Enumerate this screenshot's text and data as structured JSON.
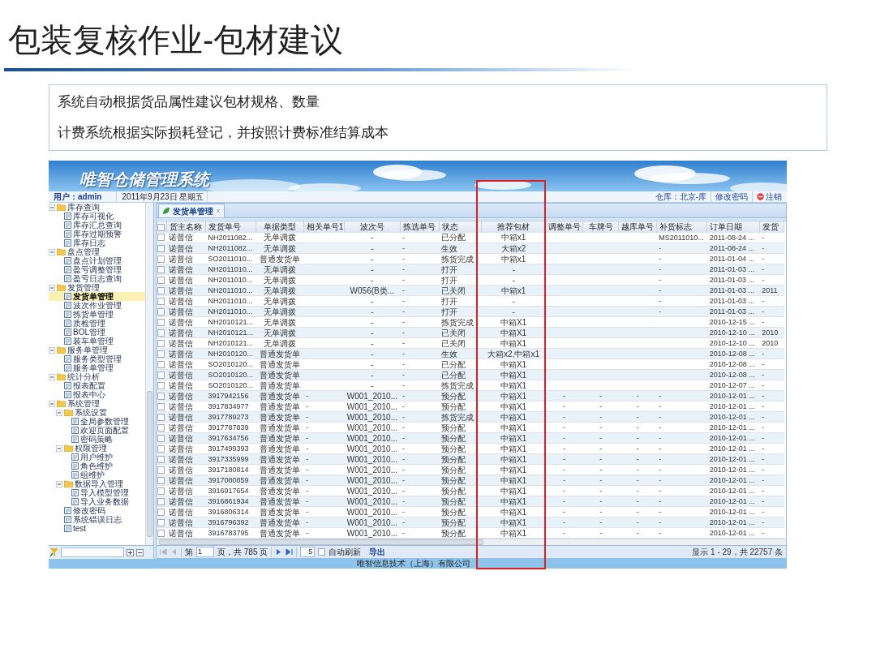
{
  "slide": {
    "title": "包装复核作业-包材建议",
    "points": [
      "系统自动根据货品属性建议包材规格、数量",
      "计费系统根据实际损耗登记，并按照计费标准结算成本"
    ]
  },
  "app": {
    "title": "唯智仓储管理系统",
    "user": "用户：admin",
    "date": "2011年9月23日 星期五",
    "warehouse": "仓库：北京-库",
    "change_password": "修改密码",
    "logout": "注销",
    "tree": [
      {
        "label": "库存查询",
        "expanded": true,
        "selected": false,
        "children": [
          {
            "label": "库存可视化",
            "selected": false
          },
          {
            "label": "库存汇总查询",
            "selected": false
          },
          {
            "label": "库存过期预警",
            "selected": false
          },
          {
            "label": "库存日志",
            "selected": false
          }
        ]
      },
      {
        "label": "盘点管理",
        "expanded": true,
        "selected": false,
        "children": [
          {
            "label": "盘点计划管理",
            "selected": false
          },
          {
            "label": "盈亏调整管理",
            "selected": false
          },
          {
            "label": "盈亏日志查询",
            "selected": false
          }
        ]
      },
      {
        "label": "发货管理",
        "expanded": true,
        "selected": false,
        "children": [
          {
            "label": "发货单管理",
            "selected": true
          },
          {
            "label": "波次作业管理",
            "selected": false
          },
          {
            "label": "拣货单管理",
            "selected": false
          },
          {
            "label": "质检管理",
            "selected": false
          },
          {
            "label": "BOL管理",
            "selected": false
          },
          {
            "label": "装车单管理",
            "selected": false
          }
        ]
      },
      {
        "label": "服务单管理",
        "expanded": true,
        "selected": false,
        "children": [
          {
            "label": "服务类型管理",
            "selected": false
          },
          {
            "label": "服务单管理",
            "selected": false
          }
        ]
      },
      {
        "label": "统计分析",
        "expanded": true,
        "selected": false,
        "children": [
          {
            "label": "报表配置",
            "selected": false
          },
          {
            "label": "报表中心",
            "selected": false
          }
        ]
      },
      {
        "label": "系统管理",
        "expanded": true,
        "selected": false,
        "children": [
          {
            "label": "系统设置",
            "expanded": true,
            "selected": false,
            "children": [
              {
                "label": "全局参数管理",
                "selected": false
              },
              {
                "label": "欢迎页面配置",
                "selected": false
              },
              {
                "label": "密码策略",
                "selected": false
              }
            ]
          },
          {
            "label": "权限管理",
            "expanded": true,
            "selected": false,
            "children": [
              {
                "label": "用户维护",
                "selected": false
              },
              {
                "label": "角色维护",
                "selected": false
              },
              {
                "label": "组维护",
                "selected": false
              }
            ]
          },
          {
            "label": "数据导入管理",
            "expanded": true,
            "selected": false,
            "children": [
              {
                "label": "导入模型管理",
                "selected": false
              },
              {
                "label": "导入业务数据",
                "selected": false
              }
            ]
          },
          {
            "label": "修改密码",
            "selected": false
          },
          {
            "label": "系统错误日志",
            "selected": false
          },
          {
            "label": "test",
            "selected": false
          }
        ]
      }
    ],
    "tab": {
      "label": "发货单管理",
      "selected": true
    },
    "select_all": {
      "checked": false
    },
    "columns": [
      "货主名称",
      "发货单号",
      "单据类型",
      "相关单号1",
      "波次号",
      "拣选单号",
      "状态",
      "推荐包材",
      "调整单号",
      "车牌号",
      "越库单号",
      "补货标志",
      "订单日期",
      "发货"
    ],
    "rows": [
      {
        "checked": false,
        "cells": [
          "诺普信",
          "NH2011082...",
          "无单调拨",
          null,
          "-",
          "-",
          "已分配",
          "中箱x1",
          null,
          null,
          null,
          "MS2011010...",
          "2011-08-24 ...",
          "-"
        ]
      },
      {
        "checked": false,
        "cells": [
          "诺普信",
          "NH2011082...",
          "无单调拨",
          null,
          "-",
          "-",
          "生效",
          "大箱x2",
          null,
          null,
          null,
          "-",
          "2011-08-24 ...",
          "-"
        ]
      },
      {
        "checked": false,
        "cells": [
          "诺普信",
          "SO2011010...",
          "普通发货单",
          null,
          "-",
          "-",
          "拣货完成",
          "中箱x1",
          null,
          null,
          null,
          "-",
          "2011-01-04 ...",
          "-"
        ]
      },
      {
        "checked": false,
        "cells": [
          "诺普信",
          "NH2011010...",
          "无单调拨",
          null,
          "-",
          "-",
          "打开",
          "-",
          null,
          null,
          null,
          "-",
          "2011-01-03 ...",
          "-"
        ]
      },
      {
        "checked": false,
        "cells": [
          "诺普信",
          "NH2011010...",
          "无单调拨",
          null,
          "-",
          "-",
          "打开",
          "-",
          null,
          null,
          null,
          "-",
          "2011-01-03 ...",
          "-"
        ]
      },
      {
        "checked": false,
        "cells": [
          "诺普信",
          "NH2011010...",
          "无单调拨",
          null,
          "W056(B类...",
          "-",
          "已关闭",
          "中箱x1",
          null,
          null,
          null,
          "-",
          "2011-01-03 ...",
          "2011"
        ]
      },
      {
        "checked": false,
        "cells": [
          "诺普信",
          "NH2011010...",
          "无单调拨",
          null,
          "-",
          "-",
          "打开",
          "-",
          null,
          null,
          null,
          "-",
          "2011-01-03 ...",
          "-"
        ]
      },
      {
        "checked": false,
        "cells": [
          "诺普信",
          "NH2011010...",
          "无单调拨",
          null,
          "-",
          "-",
          "打开",
          "-",
          null,
          null,
          null,
          "-",
          "2011-01-03 ...",
          "-"
        ]
      },
      {
        "checked": false,
        "cells": [
          "诺普信",
          "NH2010121...",
          "无单调拨",
          null,
          "-",
          "-",
          "拣货完成",
          "中箱X1",
          null,
          null,
          null,
          null,
          "2010-12-15 ...",
          "-"
        ]
      },
      {
        "checked": false,
        "cells": [
          "诺普信",
          "NH2010121...",
          "无单调拨",
          null,
          "-",
          "-",
          "已关闭",
          "中箱X1",
          null,
          null,
          null,
          null,
          "2010-12-10 ...",
          "2010"
        ]
      },
      {
        "checked": false,
        "cells": [
          "诺普信",
          "NH2010121...",
          "无单调拨",
          null,
          "-",
          "-",
          "已关闭",
          "中箱X1",
          null,
          null,
          null,
          null,
          "2010-12-10 ...",
          "2010"
        ]
      },
      {
        "checked": false,
        "cells": [
          "诺普信",
          "NH2010120...",
          "普通发货单",
          null,
          "-",
          "-",
          "生效",
          "大箱x2,中箱x1",
          null,
          null,
          null,
          null,
          "2010-12-08 ...",
          "-"
        ]
      },
      {
        "checked": false,
        "cells": [
          "诺普信",
          "SO2010120...",
          "普通发货单",
          null,
          "-",
          "-",
          "已分配",
          "中箱X1",
          null,
          null,
          null,
          null,
          "2010-12-08 ...",
          "-"
        ]
      },
      {
        "checked": false,
        "cells": [
          "诺普信",
          "SO2010120...",
          "普通发货单",
          null,
          "-",
          "-",
          "已分配",
          "中箱X1",
          null,
          null,
          null,
          null,
          "2010-12-08 ...",
          "-"
        ]
      },
      {
        "checked": false,
        "cells": [
          "诺普信",
          "SO2010120...",
          "普通发货单",
          null,
          "-",
          "-",
          "拣货完成",
          "中箱X1",
          null,
          null,
          null,
          null,
          "2010-12-07 ...",
          "-"
        ]
      },
      {
        "checked": false,
        "cells": [
          "诺普信",
          "3917942156",
          "普通发货单",
          "-",
          "W001_2010...",
          "-",
          "预分配",
          "中箱X1",
          "-",
          "-",
          "-",
          "-",
          "2010-12-01 ...",
          "-"
        ]
      },
      {
        "checked": false,
        "cells": [
          "诺普信",
          "3917834977",
          "普通发货单",
          "-",
          "W001_2010...",
          "-",
          "预分配",
          "中箱X1",
          "-",
          "-",
          "-",
          "-",
          "2010-12-01 ...",
          "-"
        ]
      },
      {
        "checked": false,
        "cells": [
          "诺普信",
          "3917789273",
          "普通发货单",
          "-",
          "W001_2010...",
          "-",
          "拣货完成",
          "中箱X1",
          "-",
          "-",
          "-",
          "-",
          "2010-12-01 ...",
          "-"
        ]
      },
      {
        "checked": false,
        "cells": [
          "诺普信",
          "3917787839",
          "普通发货单",
          "-",
          "W001_2010...",
          "-",
          "预分配",
          "中箱X1",
          "-",
          "-",
          "-",
          "-",
          "2010-12-01 ...",
          "-"
        ]
      },
      {
        "checked": false,
        "cells": [
          "诺普信",
          "3917634756",
          "普通发货单",
          "-",
          "W001_2010...",
          "-",
          "预分配",
          "中箱X1",
          "-",
          "-",
          "-",
          "-",
          "2010-12-01 ...",
          "-"
        ]
      },
      {
        "checked": false,
        "cells": [
          "诺普信",
          "3917499393",
          "普通发货单",
          "-",
          "W001_2010...",
          "-",
          "预分配",
          "中箱X1",
          "-",
          "-",
          "-",
          "-",
          "2010-12-01 ...",
          "-"
        ]
      },
      {
        "checked": false,
        "cells": [
          "诺普信",
          "3917335999",
          "普通发货单",
          "-",
          "W001_2010...",
          "-",
          "预分配",
          "中箱X1",
          "-",
          "-",
          "-",
          "-",
          "2010-12-01 ...",
          "-"
        ]
      },
      {
        "checked": false,
        "cells": [
          "诺普信",
          "3917180814",
          "普通发货单",
          "-",
          "W001_2010...",
          "-",
          "预分配",
          "中箱X1",
          "-",
          "-",
          "-",
          "-",
          "2010-12-01 ...",
          "-"
        ]
      },
      {
        "checked": false,
        "cells": [
          "诺普信",
          "3917080859",
          "普通发货单",
          "-",
          "W001_2010...",
          "-",
          "预分配",
          "中箱X1",
          "-",
          "-",
          "-",
          "-",
          "2010-12-01 ...",
          "-"
        ]
      },
      {
        "checked": false,
        "cells": [
          "诺普信",
          "3916917654",
          "普通发货单",
          "-",
          "W001_2010...",
          "-",
          "预分配",
          "中箱X1",
          "-",
          "-",
          "-",
          "-",
          "2010-12-01 ...",
          "-"
        ]
      },
      {
        "checked": false,
        "cells": [
          "诺普信",
          "3916861934",
          "普通发货单",
          "-",
          "W001_2010...",
          "-",
          "预分配",
          "中箱X1",
          "-",
          "-",
          "-",
          "-",
          "2010-12-01 ...",
          "-"
        ]
      },
      {
        "checked": false,
        "cells": [
          "诺普信",
          "3916806314",
          "普通发货单",
          "-",
          "W001_2010...",
          "-",
          "预分配",
          "中箱X1",
          "-",
          "-",
          "-",
          "-",
          "2010-12-01 ...",
          "-"
        ]
      },
      {
        "checked": false,
        "cells": [
          "诺普信",
          "3916796392",
          "普通发货单",
          "-",
          "W001_2010...",
          "-",
          "预分配",
          "中箱X1",
          "-",
          "-",
          "-",
          "-",
          "2010-12-01 ...",
          "-"
        ]
      },
      {
        "checked": false,
        "cells": [
          "诺普信",
          "3916783795",
          "普通发货单",
          "-",
          "W001_2010...",
          "-",
          "预分配",
          "中箱X1",
          "-",
          "-",
          "-",
          "-",
          "2010-12-01 ...",
          "-"
        ]
      }
    ],
    "pager": {
      "page_prefix": "第",
      "page": "1",
      "page_suffix": "页，共 785 页",
      "page_size": "5",
      "auto_refresh": {
        "label": "自动刷新",
        "checked": false
      },
      "export": "导出",
      "summary": "显示 1 - 29，共 22757 条"
    },
    "footer": "唯智信息技术（上海）有限公司"
  }
}
